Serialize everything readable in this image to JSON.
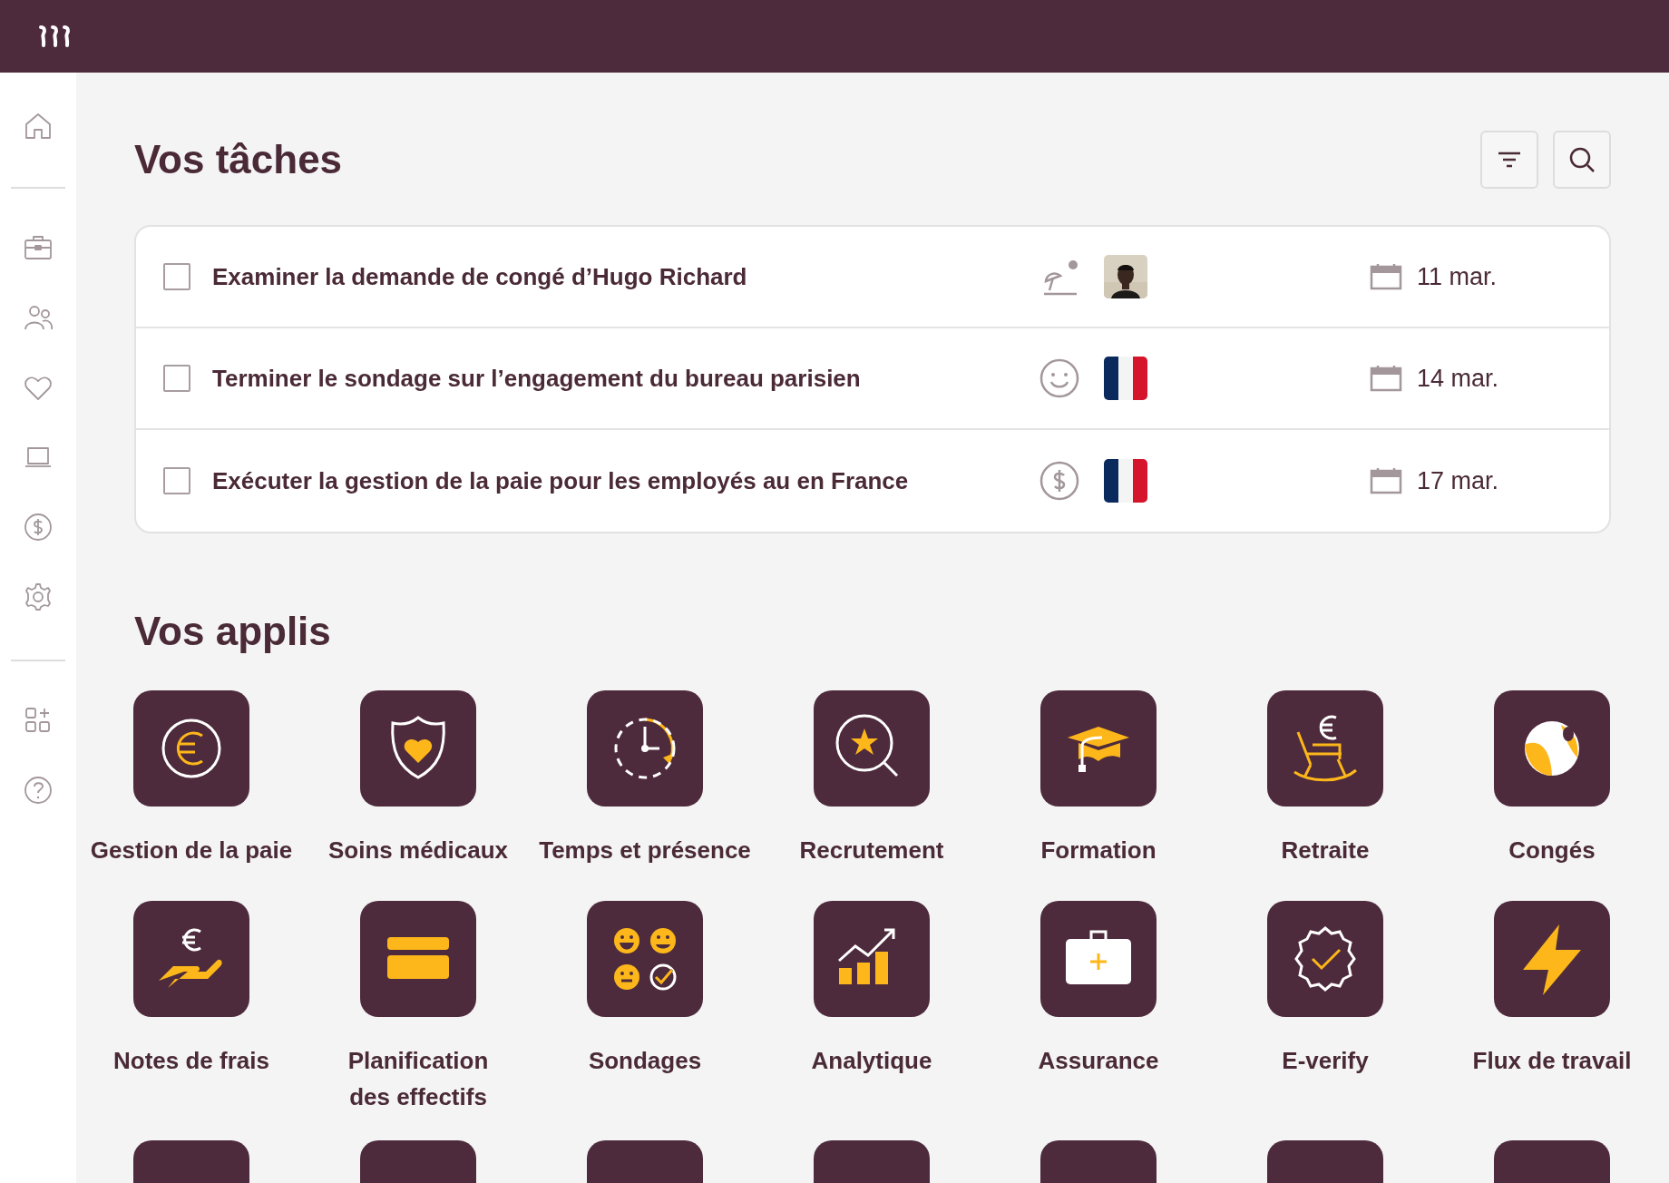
{
  "tasks_section": {
    "title": "Vos tâches"
  },
  "tasks": [
    {
      "text": "Examiner la demande de congé d’Hugo Richard",
      "checked": false,
      "assignee": {
        "kind": "person"
      },
      "date": "11 mar."
    },
    {
      "text": "Terminer le sondage sur l’engagement du bureau parisien",
      "checked": false,
      "assignee": {
        "kind": "flag"
      },
      "date": "14 mar."
    },
    {
      "text": "Exécuter la gestion de la paie pour les employés au en France",
      "checked": false,
      "assignee": {
        "kind": "flag"
      },
      "date": "17 mar."
    }
  ],
  "apps_section": {
    "title": "Vos applis"
  },
  "apps": [
    {
      "label": "Gestion de la paie"
    },
    {
      "label": "Soins médicaux"
    },
    {
      "label": "Temps et présence"
    },
    {
      "label": "Recrutement"
    },
    {
      "label": "Formation"
    },
    {
      "label": "Retraite"
    },
    {
      "label": "Congés"
    },
    {
      "label": "Notes de frais"
    },
    {
      "label": "Planification des effectifs"
    },
    {
      "label": "Sondages"
    },
    {
      "label": "Analytique"
    },
    {
      "label": "Assurance"
    },
    {
      "label": "E-verify"
    },
    {
      "label": "Flux de travail"
    },
    {
      "kind": "cut"
    },
    {
      "kind": "cut"
    },
    {
      "kind": "cut"
    },
    {
      "kind": "cut"
    },
    {
      "kind": "cut"
    },
    {
      "kind": "cut"
    },
    {
      "kind": "cut"
    }
  ]
}
